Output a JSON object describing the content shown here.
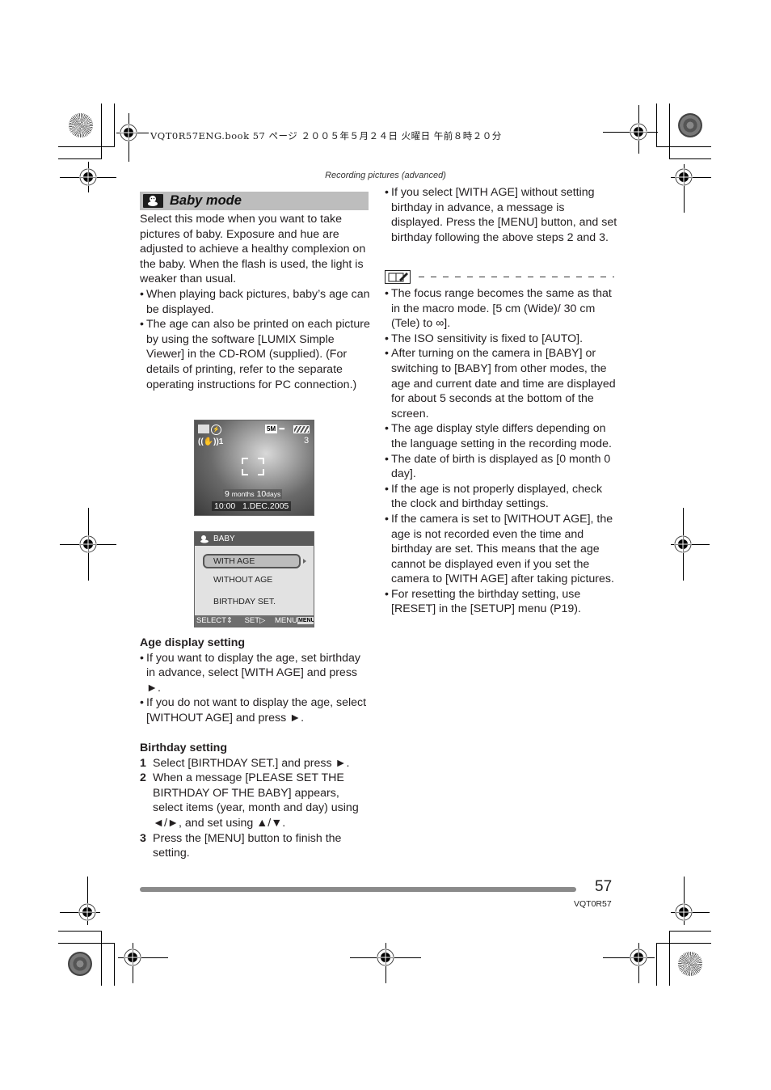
{
  "print_header": {
    "book_info": "VQT0R57ENG.book  57 ページ  ２００５年５月２４日  火曜日  午前８時２０分"
  },
  "running_head": "Recording pictures (advanced)",
  "section": {
    "icon": "baby-mode-icon",
    "title": "Baby mode",
    "intro": "Select this mode when you want to take pictures of baby. Exposure and hue are adjusted to achieve a healthy complexion on the baby. When the flash is used, the light is weaker than usual.",
    "bullets": [
      "When playing back pictures, baby’s age can be displayed.",
      "The age can also be printed on each picture by using the software [LUMIX Simple Viewer] in the CD-ROM (supplied). (For details of printing, refer to the separate operating instructions for PC connection.)"
    ]
  },
  "screen_preview": {
    "megapixel": "5M",
    "quality": "▪▪▪",
    "ois": "((✋))1",
    "shots_remaining": "3",
    "age_number_months": "9",
    "age_unit_months": "months",
    "age_number_days": "10",
    "age_unit_days": "days",
    "time": "10:00",
    "date": "1.DEC.2005"
  },
  "screen_menu": {
    "title": "BABY",
    "items": [
      "WITH AGE",
      "WITHOUT AGE",
      "BIRTHDAY SET."
    ],
    "selected_index": 0,
    "footer_select": "SELECT⇕",
    "footer_set": "SET▷",
    "footer_menu": "MENU",
    "footer_menu_badge": "MENU"
  },
  "age_display": {
    "heading": "Age display setting",
    "bullets": [
      "If you want to display the age, set birthday in advance, select [WITH AGE] and press ►.",
      "If you do not want to display the age, select [WITHOUT AGE] and press ►."
    ]
  },
  "birthday_setting": {
    "heading": "Birthday setting",
    "steps": [
      {
        "num": "1",
        "text": "Select [BIRTHDAY SET.] and press ►."
      },
      {
        "num": "2",
        "text": "When a message [PLEASE SET THE BIRTHDAY OF THE BABY] appears, select items (year, month and day) using ◄/►, and set using ▲/▼."
      },
      {
        "num": "3",
        "text": "Press the [MENU] button to finish the setting."
      }
    ]
  },
  "right_column": {
    "top_bullet": "If you select [WITH AGE] without setting birthday in advance, a message is displayed. Press the [MENU] button, and set birthday following the above steps 2 and 3.",
    "note_icon": "note-icon",
    "notes": [
      "The focus range becomes the same as that in the macro mode. [5 cm (Wide)/ 30 cm (Tele) to ∞].",
      "The ISO sensitivity is fixed to [AUTO].",
      "After turning on the camera in [BABY] or switching to [BABY] from other modes, the age and current date and time are displayed for about 5 seconds at the bottom of the screen.",
      "The age display style differs depending on the language setting in the recording mode.",
      "The date of birth is displayed as [0 month 0 day].",
      "If the age is not properly displayed, check the clock and birthday settings.",
      "If the camera is set to [WITHOUT AGE], the age is not recorded even the time and birthday are set. This means that the age cannot be displayed even if you set the camera to [WITH AGE] after taking pictures.",
      "For resetting the birthday setting, use [RESET] in the [SETUP] menu (P19)."
    ]
  },
  "footer": {
    "page_number": "57",
    "model_code": "VQT0R57"
  }
}
